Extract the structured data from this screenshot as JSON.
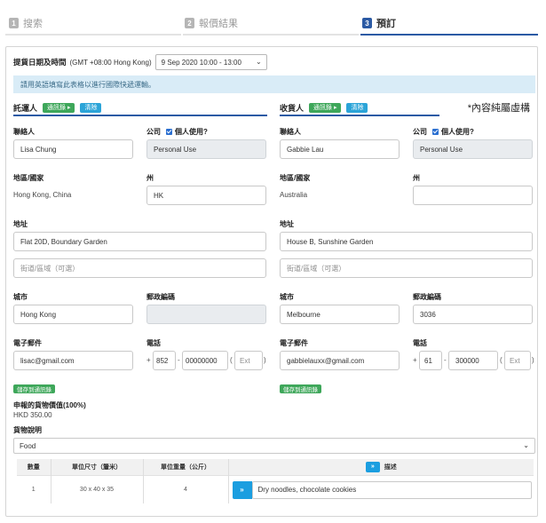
{
  "steps": [
    {
      "num": "1",
      "label": "搜索"
    },
    {
      "num": "2",
      "label": "報價結果"
    },
    {
      "num": "3",
      "label": "預訂"
    }
  ],
  "pickup": {
    "label": "提貨日期及時間",
    "timezone": "(GMT +08:00 Hong Kong)",
    "selected": "9 Sep 2020 10:00 - 13:00"
  },
  "info_text": "請用英語填寫此表格以進行國際快遞運輸。",
  "note": "*內容純屬虛構",
  "shipper": {
    "title": "託運人",
    "address_book_label": "通訊錄 ▸",
    "clear_label": "清除",
    "contact_label": "聯絡人",
    "contact": "Lisa Chung",
    "company_label": "公司",
    "personal_use_label": "個人使用?",
    "company_value": "Personal Use",
    "region_label": "地區/國家",
    "region": "Hong Kong, China",
    "state_label": "州",
    "state": "HK",
    "address_label": "地址",
    "address": "Flat 20D, Boundary Garden",
    "street_placeholder": "街道/區域（可選）",
    "city_label": "城市",
    "city": "Hong Kong",
    "postcode_label": "郵政編碼",
    "postcode": "",
    "email_label": "電子郵件",
    "email": "lisac@gmail.com",
    "phone_label": "電話",
    "phone_plus": "+",
    "phone_code": "852",
    "phone_number": "00000000",
    "ext_placeholder": "Ext",
    "save_label": "儲存到通訊錄"
  },
  "receiver": {
    "title": "收貨人",
    "address_book_label": "通訊錄 ▸",
    "clear_label": "清除",
    "contact_label": "聯絡人",
    "contact": "Gabbie Lau",
    "company_label": "公司",
    "personal_use_label": "個人使用?",
    "company_value": "Personal Use",
    "region_label": "地區/國家",
    "region": "Australia",
    "state_label": "州",
    "state": "",
    "address_label": "地址",
    "address": "House B, Sunshine Garden",
    "street_placeholder": "街道/區域（可選）",
    "city_label": "城市",
    "city": "Melbourne",
    "postcode_label": "郵政編碼",
    "postcode": "3036",
    "email_label": "電子郵件",
    "email": "gabbielauxx@gmail.com",
    "phone_label": "電話",
    "phone_plus": "+",
    "phone_code": "61",
    "phone_number": "300000",
    "ext_placeholder": "Ext",
    "save_label": "儲存到通訊錄"
  },
  "declared": {
    "label": "申報的貨物價值(100%)",
    "value": "HKD 350.00"
  },
  "goods_desc": {
    "label": "貨物說明",
    "selected": "Food"
  },
  "table": {
    "headers": {
      "qty": "數量",
      "size": "單位尺寸（釐米）",
      "weight": "單位重量（公斤）",
      "desc_btn": "»",
      "desc": "描述"
    },
    "rows": [
      {
        "qty": "1",
        "size": "30 x 40 x 35",
        "weight": "4",
        "btn": "»",
        "desc": "Dry noodles, chocolate cookies"
      }
    ]
  },
  "colors": {
    "accent": "#2b5aa4",
    "green": "#3ea75a",
    "info_bg": "#d9ecf7"
  }
}
